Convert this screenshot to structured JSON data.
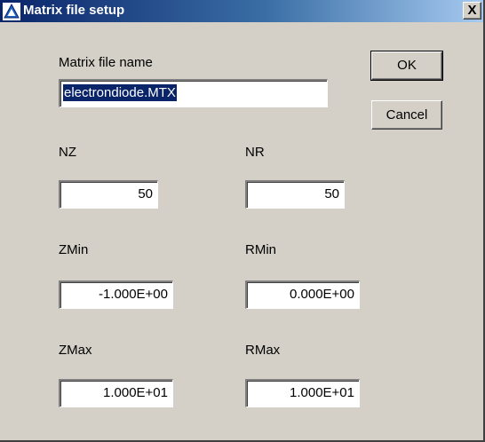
{
  "window": {
    "title": "Matrix file setup",
    "close_label": "X"
  },
  "form": {
    "file_name": {
      "label": "Matrix file name",
      "value": "electrondiode.MTX"
    },
    "nz": {
      "label": "NZ",
      "value": "50"
    },
    "nr": {
      "label": "NR",
      "value": "50"
    },
    "zmin": {
      "label": "ZMin",
      "value": "-1.000E+00"
    },
    "rmin": {
      "label": "RMin",
      "value": "0.000E+00"
    },
    "zmax": {
      "label": "ZMax",
      "value": "1.000E+01"
    },
    "rmax": {
      "label": "RMax",
      "value": "1.000E+01"
    }
  },
  "buttons": {
    "ok": "OK",
    "cancel": "Cancel"
  },
  "colors": {
    "title_start": "#0a246a",
    "title_end": "#a6caf0",
    "dialog_bg": "#d4d0c8",
    "selection": "#0a246a"
  }
}
